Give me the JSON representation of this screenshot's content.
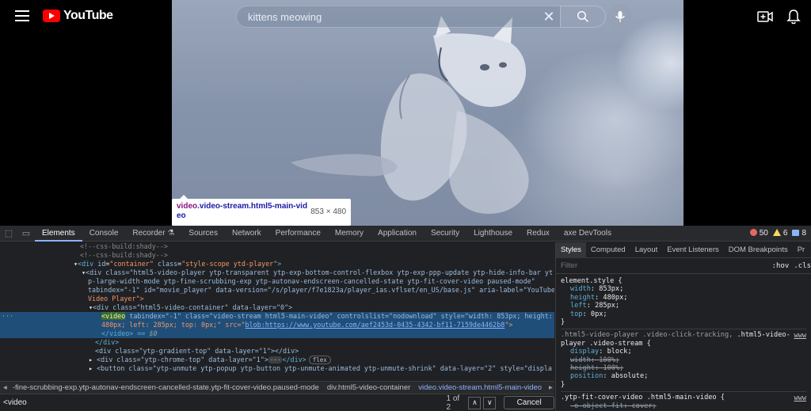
{
  "youtube": {
    "logo_text": "YouTube",
    "search_value": "kittens meowing",
    "clear_glyph": "✕",
    "icons": [
      "menu-icon",
      "youtube-logo-icon",
      "clear-icon",
      "search-icon",
      "microphone-icon",
      "create-video-icon",
      "bell-icon"
    ]
  },
  "inspect_tooltip": {
    "tag": "video",
    "classes": ".video-stream.html5-main-vid",
    "classes_cont": "eo",
    "size": "853 × 480"
  },
  "devtools": {
    "tabs": [
      "Elements",
      "Console",
      "Recorder",
      "Sources",
      "Network",
      "Performance",
      "Memory",
      "Application",
      "Security",
      "Lighthouse",
      "Redux",
      "axe DevTools"
    ],
    "recorder_suffix": "⚗",
    "errors": "50",
    "warnings": "6",
    "infos": "8",
    "code": {
      "l1": "<!--css-build:shady-->",
      "l2": "<!--css-build:shady-->",
      "l3_tag": "div",
      "l3_id_attr": "id",
      "l3_id_val": "\"container\"",
      "l3_class_attr": "class",
      "l3_class_val": "\"style-scope ytd-player\"",
      "l4a": "<div class=\"html5-video-player ytp-transparent ytp-exp-bottom-control-flexbox ytp-exp-ppp-update ytp-hide-info-bar yt",
      "l4b": "p-large-width-mode ytp-fine-scrubbing-exp ytp-autonav-endscreen-cancelled-state ytp-fit-cover-video paused-mode\"",
      "l4c": "tabindex=\"-1\" id=\"movie_player\" data-version=\"/s/player/f7e1823a/player_ias.vflset/en_US/base.js\" aria-label=\"YouTube",
      "l4d": "Video Player\">",
      "l5": "<div class=\"html5-video-container\" data-layer=\"0\">",
      "l6_gutter": "···",
      "l6_tag": "<video",
      "l6a": " tabindex=\"-1\" class=\"video-stream html5-main-video\" controlslist=\"nodownload\" style=\"width: 853px; height:",
      "l6b_pre": "480px; left: 285px; top: 0px;\" src=\"",
      "l6b_link": "blob:https://www.youtube.com/aef2453d-0435-4342-bf11-7159de4462b8",
      "l6b_post": "\">",
      "l6c": "</video> == ",
      "l6c_dollar": "$0",
      "l7": "</div>",
      "l8": "<div class=\"ytp-gradient-top\" data-layer=\"1\"></div>",
      "l9_pre": "<div class=\"ytp-chrome-top\" data-layer=\"1\">",
      "l9_ellipsis": "···",
      "l9_post": "</div>",
      "l9_flex": "flex",
      "l10": "<button class=\"ytp-unmute ytp-popup ytp-button ytp-unmute-animated ytp-unmute-shrink\" data-layer=\"2\" style=\"displa"
    },
    "breadcrumbs": {
      "prefix": "◂",
      "c1": "-fine-scrubbing-exp.ytp-autonav-endscreen-cancelled-state.ytp-fit-cover-video.paused-mode",
      "c2": "div.html5-video-container",
      "c3": "video.video-stream.html5-main-video",
      "suffix": "▸"
    },
    "find": {
      "value": "<video",
      "count": "1 of 2",
      "up": "∧",
      "down": "∨",
      "cancel": "Cancel"
    },
    "styles": {
      "subtabs": [
        "Styles",
        "Computed",
        "Layout",
        "Event Listeners",
        "DOM Breakpoints",
        "Pr"
      ],
      "filter_placeholder": "Filter",
      "hov": ":hov",
      "cls": ".cls",
      "rule1": {
        "selector": "element.style {",
        "props": [
          {
            "name": "width",
            "value": "853px;"
          },
          {
            "name": "height",
            "value": "480px;"
          },
          {
            "name": "left",
            "value": "285px;"
          },
          {
            "name": "top",
            "value": "0px;"
          }
        ],
        "close": "}"
      },
      "rule2": {
        "selector_dim": ".html5-video-player .video-click-tracking, ",
        "selector_main": ".html5-video-",
        "selector_line2": "player .video-stream {",
        "source": "www",
        "props": [
          {
            "name": "display",
            "value": "block;"
          },
          {
            "name": "width",
            "value": "100%;"
          },
          {
            "name": "height",
            "value": "100%;"
          },
          {
            "name": "position",
            "value": "absolute;"
          }
        ],
        "close": "}"
      },
      "rule3": {
        "selector": ".ytp-fit-cover-video .html5-main-video {",
        "source": "www",
        "props": [
          {
            "name": "-o-object-fit",
            "value": "cover;"
          }
        ]
      }
    }
  }
}
